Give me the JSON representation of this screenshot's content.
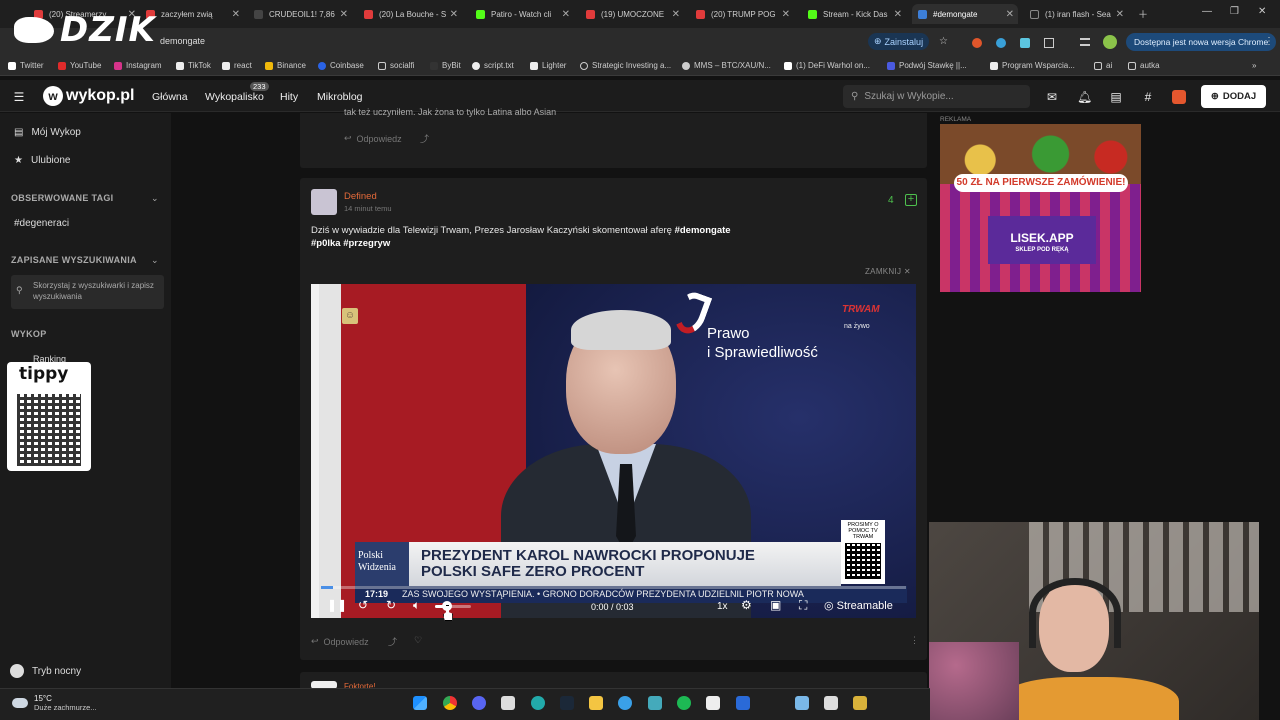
{
  "browser": {
    "tabs": [
      {
        "label": "(20) Streamerzy",
        "color": "#e03b3b"
      },
      {
        "label": "zaczyłem zwią",
        "color": "#e03b3b"
      },
      {
        "label": "CRUDEOIL1! 7,86",
        "color": "#444"
      },
      {
        "label": "(20) La Bouche - S",
        "color": "#e03b3b"
      },
      {
        "label": "Patiro - Watch cli",
        "color": "#53fc18"
      },
      {
        "label": "(19) UMOCZONE",
        "color": "#e03b3b"
      },
      {
        "label": "(20) TRUMP POG",
        "color": "#e03b3b"
      },
      {
        "label": "Stream - Kick Das",
        "color": "#53fc18"
      },
      {
        "label": "#demongate",
        "color": "#3d7fd8"
      },
      {
        "label": "(1) iran flash - Sea",
        "color": "#222"
      }
    ],
    "url": "demongate",
    "install_label": "Zainstaluj",
    "update_label": "Dostępna jest nowa wersja Chrome",
    "bookmarks": [
      "Twitter",
      "YouTube",
      "Instagram",
      "TikTok",
      "react",
      "Binance",
      "Coinbase",
      "socialfi",
      "ByBit",
      "script.txt",
      "Lighter",
      "Strategic Investing a...",
      "MMS – BTC/XAU/N...",
      "(1) DeFi Warhol on...",
      "Podwój Stawkę ||...",
      "Program Wsparcia...",
      "ai",
      "autka"
    ]
  },
  "overlay": {
    "logo_text": "DZIK",
    "tippy_text": "tippy"
  },
  "wykop": {
    "logo": "wykop.pl",
    "nav": [
      "Główna",
      "Wykopalisko",
      "Hity",
      "Mikroblog"
    ],
    "wykopalisko_badge": "233",
    "search_placeholder": "Szukaj w Wykopie...",
    "add_label": "DODAJ"
  },
  "sidebar": {
    "my_wykop": "Mój Wykop",
    "favorites": "Ulubione",
    "observed_tags_header": "OBSERWOWANE TAGI",
    "observed_tag": "#degeneraci",
    "saved_searches_header": "ZAPISANE WYSZUKIWANIA",
    "saved_hint": "Skorzystaj z wyszukiwarki i zapisz wyszukiwania",
    "wykop_header": "WYKOP",
    "ranking": "Ranking",
    "night_mode": "Tryb nocny"
  },
  "posts": {
    "prev_tail": "tak też uczyniłem. Jak żona to tylko Latina albo Asian",
    "reply_label": "Odpowiedz",
    "main": {
      "author": "Defined",
      "time": "14 minut temu",
      "votes": "4",
      "text_line1": "Dziś w wywiadzie dla Telewizji Trwam, Prezes Jarosław Kaczyński skomentował aferę",
      "tag1": "#demongate",
      "tag2": "#p0lka",
      "tag3": "#przegryw",
      "close_label": "ZAMKNIJ"
    },
    "next_author": "Foktorte!"
  },
  "video": {
    "pis_line1": "Prawo",
    "pis_line2": "i Sprawiedliwość",
    "channel": "TRWAM",
    "live": "na żywo",
    "chyron_logo_line1": "Polski",
    "chyron_logo_line2": "Widzenia",
    "headline_line1": "PREZYDENT KAROL NAWROCKI PROPONUJE",
    "headline_line2": "POLSKI SAFE ZERO PROCENT",
    "clock": "17:19",
    "ticker": "ZAS SWOJEGO WYSTĄPIENIA.  •  GRONO DORADCÓW PREZYDENTA UDZIELNIL PIOTR NOWA",
    "qr_text": "PROSIMY O POMOC TV TRWAM",
    "time": "0:00 / 0:03",
    "speed": "1x",
    "brand": "Streamable",
    "progress": 0.02,
    "volume": 0.3
  },
  "ad": {
    "label": "REKLAMA",
    "promo": "50 ZŁ NA PIERWSZE ZAMÓWIENIE!",
    "brand": "LISEK.APP",
    "tagline": "SKLEP POD RĘKĄ"
  },
  "taskbar": {
    "temp": "15°C",
    "weather": "Duże zachmurze..."
  }
}
